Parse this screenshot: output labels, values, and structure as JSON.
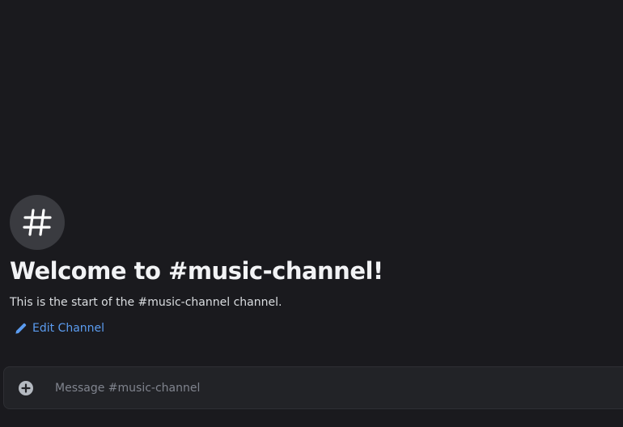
{
  "channel": {
    "icon": "hashtag-icon",
    "welcome_title": "Welcome to #music-channel!",
    "welcome_subtitle": "This is the start of the #music-channel channel.",
    "edit_label": "Edit Channel",
    "edit_icon": "pencil-icon"
  },
  "composer": {
    "attach_icon": "plus-circle-icon",
    "placeholder": "Message #music-channel"
  },
  "colors": {
    "background": "#1a1a1e",
    "link": "#5b9cf0",
    "composer_bg": "#222327"
  }
}
